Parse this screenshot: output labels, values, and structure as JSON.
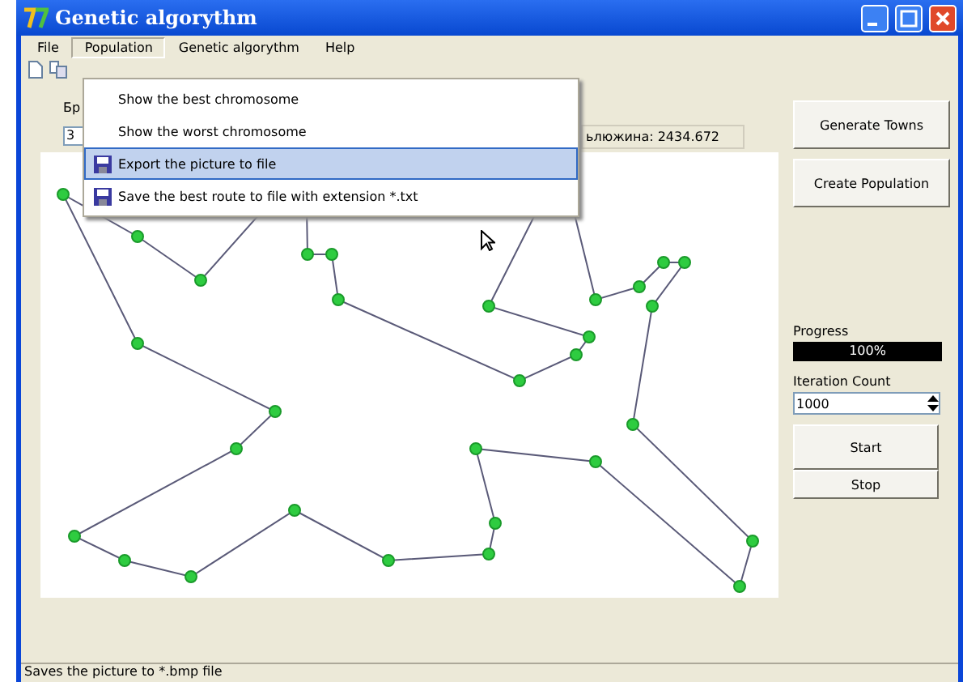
{
  "window": {
    "title": "Genetic algorythm"
  },
  "menubar": [
    {
      "label": "File",
      "selected": false
    },
    {
      "label": "Population",
      "selected": true
    },
    {
      "label": "Genetic algorythm",
      "selected": false
    },
    {
      "label": "Help",
      "selected": false
    }
  ],
  "population_menu": [
    {
      "label": "Show the best chromosome",
      "kind": "plain",
      "selected": false
    },
    {
      "label": "Show the worst chromosome",
      "kind": "plain",
      "selected": false
    },
    {
      "label": "Export the picture to file",
      "kind": "save",
      "selected": true
    },
    {
      "label": "Save the best route to file with extension *.txt",
      "kind": "save",
      "selected": false
    }
  ],
  "params": {
    "label": "Бр",
    "field_value": "3",
    "result_text": "ьлюжина: 2434.672"
  },
  "buttons": [
    "Generate Towns",
    "Create Population"
  ],
  "progress": {
    "label": "Progress",
    "level": 1,
    "reading": "100%"
  },
  "iteration": {
    "label": "Iteration Count",
    "value": "1000"
  },
  "run_buttons": [
    "Start",
    "Stop"
  ],
  "status_bar": {
    "text": "Saves the picture to *.bmp file"
  }
}
